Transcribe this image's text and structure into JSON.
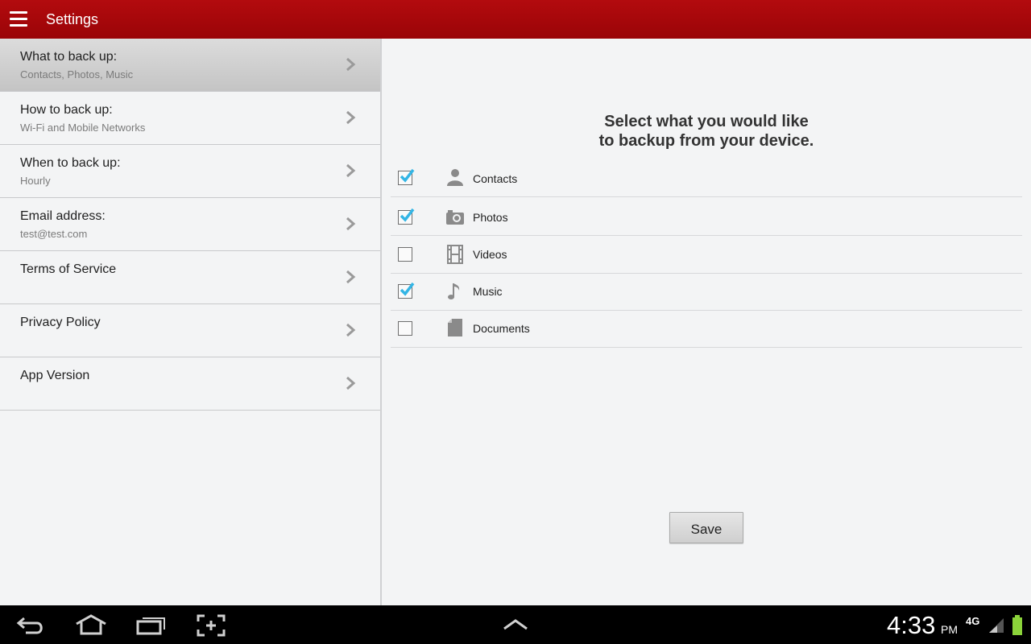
{
  "app_bar": {
    "title": "Settings",
    "menu_icon": "hamburger-menu-icon",
    "color": "#a8070b"
  },
  "sidebar": {
    "items": [
      {
        "label": "What to back up:",
        "sub": "Contacts, Photos, Music",
        "active": true
      },
      {
        "label": "How to back up:",
        "sub": "Wi-Fi and Mobile Networks"
      },
      {
        "label": "When to back up:",
        "sub": "Hourly"
      },
      {
        "label": "Email address:",
        "sub": "test@test.com"
      },
      {
        "label": "Terms of Service",
        "sub": ""
      },
      {
        "label": "Privacy Policy",
        "sub": ""
      },
      {
        "label": "App Version",
        "sub": ""
      }
    ]
  },
  "content": {
    "heading_line1": "Select what you would like",
    "heading_line2": "to backup from your device.",
    "options": [
      {
        "label": "Contacts",
        "checked": true,
        "icon": "person-icon"
      },
      {
        "label": "Photos",
        "checked": true,
        "icon": "camera-icon"
      },
      {
        "label": "Videos",
        "checked": false,
        "icon": "film-icon"
      },
      {
        "label": "Music",
        "checked": true,
        "icon": "music-note-icon"
      },
      {
        "label": "Documents",
        "checked": false,
        "icon": "document-icon"
      }
    ],
    "save_label": "Save",
    "check_color": "#33b5e5"
  },
  "system_bar": {
    "time": "4:33",
    "ampm": "PM",
    "network": "4G",
    "icons": [
      "back-icon",
      "home-icon",
      "recent-apps-icon",
      "screenshot-icon",
      "up-arrow-icon",
      "signal-icon",
      "battery-icon"
    ]
  }
}
